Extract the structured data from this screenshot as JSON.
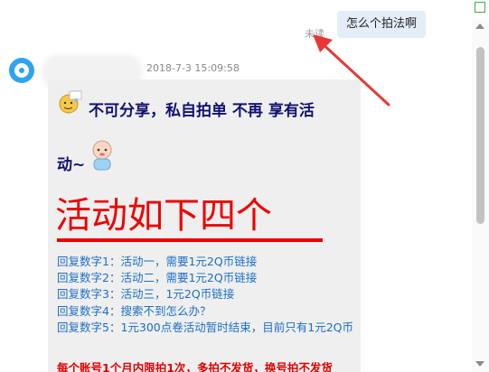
{
  "outgoing": {
    "text": "怎么个拍法啊",
    "status": "未读"
  },
  "incoming": {
    "timestamp": "2018-7-3 15:09:58",
    "line1": "不可分享，私自拍单 不再 享有活",
    "line2": "动~",
    "headline": "活动如下四个",
    "replies": [
      "回复数字1：活动一，需要1元2Q币链接",
      "回复数字2：活动二，需要1元2Q币链接",
      "回复数字3：活动三，1元2Q币链接",
      "回复数字4：搜索不到怎么办？",
      "回复数字5：1元300点卷活动暂时结束，目前只有1元2Q币"
    ],
    "warning": "每个账号1个月内限拍1次，多拍不发货，换号拍不发货"
  },
  "colors": {
    "headline_red": "#ee0000",
    "link_blue": "#1b6fc5",
    "bold_navy": "#101070",
    "bubble_blue": "#e3eef9",
    "arrow_red": "#e53935"
  }
}
